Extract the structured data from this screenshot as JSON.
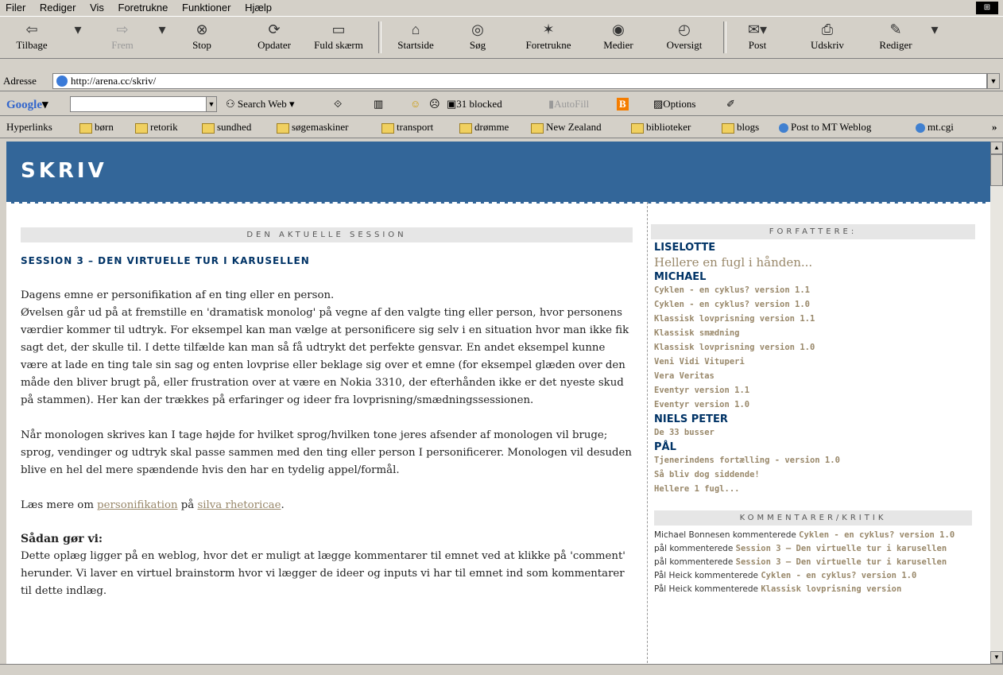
{
  "menu": [
    "Filer",
    "Rediger",
    "Vis",
    "Foretrukne",
    "Funktioner",
    "Hjælp"
  ],
  "toolbar": {
    "back": "Tilbage",
    "forward": "Frem",
    "stop": "Stop",
    "refresh": "Opdater",
    "fullscreen": "Fuld skærm",
    "home": "Startside",
    "search": "Søg",
    "favorites": "Foretrukne",
    "media": "Medier",
    "history": "Oversigt",
    "mail": "Post",
    "print": "Udskriv",
    "edit": "Rediger"
  },
  "address": {
    "label": "Adresse",
    "url": "http://arena.cc/skriv/"
  },
  "googlebar": {
    "logo": "Google",
    "search_web": "Search Web",
    "blocked": "31 blocked",
    "autofill": "AutoFill",
    "options": "Options"
  },
  "links": {
    "label": "Hyperlinks",
    "items": [
      "børn",
      "retorik",
      "sundhed",
      "søgemaskiner",
      "transport",
      "drømme",
      "New Zealand",
      "biblioteker",
      "blogs",
      "Post to MT Weblog",
      "mt.cgi"
    ]
  },
  "page": {
    "title": "SKRIV",
    "section_head": "DEN AKTUELLE SESSION",
    "session_title": "SESSION 3 – DEN VIRTUELLE TUR I KARUSELLEN",
    "para1_line1": "Dagens emne er personifikation af en ting eller en person.",
    "para1": "Øvelsen går ud på at fremstille en 'dramatisk monolog' på vegne af den valgte ting eller person, hvor personens værdier kommer til udtryk. For eksempel kan man vælge at personificere sig selv i en situation hvor man ikke fik sagt det, der skulle til. I dette tilfælde kan man så få udtrykt det perfekte gensvar. En andet eksempel kunne være at lade en ting tale sin sag og enten lovprise eller beklage sig over et emne (for eksempel glæden over den måde den bliver brugt på, eller frustration over at være en Nokia 3310, der efterhånden ikke er det nyeste skud på stammen). Her kan der trækkes på erfaringer og ideer fra lovprisning/smædningssessionen.",
    "para2": "Når monologen skrives kan I tage højde for hvilket sprog/hvilken tone jeres afsender af monologen vil bruge; sprog, vendinger og udtryk skal passe sammen med den ting eller person I personificerer. Monologen vil desuden blive en hel del mere spændende hvis den har en tydelig appel/formål.",
    "read_more_pre": "Læs mere om ",
    "read_more_link1": "personifikation",
    "read_more_mid": " på ",
    "read_more_link2": "silva rhetoricae",
    "read_more_post": ".",
    "howto_head": "Sådan gør vi:",
    "howto": "Dette oplæg ligger på en weblog, hvor det er muligt at lægge kommentarer til emnet ved at klikke på 'comment' herunder. Vi laver en virtuel brainstorm hvor vi lægger de ideer og inputs vi har til emnet ind som kommentarer til dette indlæg."
  },
  "sidebar": {
    "authors_head": "FORFATTERE:",
    "authors": [
      {
        "name": "LISELOTTE",
        "featured": "Hellere en fugl i hånden...",
        "posts": []
      },
      {
        "name": "MICHAEL",
        "posts": [
          "Cyklen - en cyklus? version 1.1",
          "Cyklen - en cyklus? version 1.0",
          "Klassisk lovprisning version 1.1",
          "Klassisk smædning",
          "Klassisk lovprisning version 1.0",
          "Veni Vidi Vituperi",
          "Vera Veritas",
          "Eventyr version 1.1",
          "Eventyr version 1.0"
        ]
      },
      {
        "name": "NIELS PETER",
        "posts": [
          "De 33 busser"
        ]
      },
      {
        "name": "PÅL",
        "posts": [
          "Tjenerindens fortælling - version 1.0",
          "Så bliv dog siddende!",
          "Hellere 1 fugl..."
        ]
      }
    ],
    "comments_head": "KOMMENTARER/KRITIK",
    "comments": [
      {
        "who": "Michael Bonnesen kommenterede ",
        "what": "Cyklen - en cyklus? version 1.0"
      },
      {
        "who": "pål kommenterede ",
        "what": "Session 3 – Den virtuelle tur i karusellen"
      },
      {
        "who": "pål kommenterede ",
        "what": "Session 3 – Den virtuelle tur i karusellen"
      },
      {
        "who": "Pål Heick kommenterede ",
        "what": "Cyklen - en cyklus? version 1.0"
      },
      {
        "who": "Pål Heick kommenterede ",
        "what": "Klassisk lovprisning version"
      }
    ]
  }
}
